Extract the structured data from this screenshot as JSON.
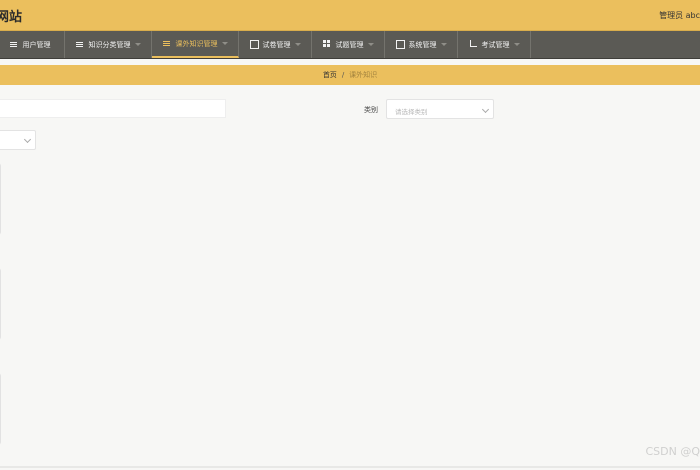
{
  "header": {
    "site_title": "网站",
    "user_info": "管理员 abc"
  },
  "nav": {
    "items": [
      {
        "label": "用户管理",
        "icon": "list-icon",
        "active": false
      },
      {
        "label": "知识分类管理",
        "icon": "list-icon",
        "active": false
      },
      {
        "label": "课外知识管理",
        "icon": "list-icon",
        "active": true
      },
      {
        "label": "试卷管理",
        "icon": "document-icon",
        "active": false
      },
      {
        "label": "试题管理",
        "icon": "grid-icon",
        "active": false
      },
      {
        "label": "系统管理",
        "icon": "settings-icon",
        "active": false
      },
      {
        "label": "考试管理",
        "icon": "crop-icon",
        "active": false
      }
    ]
  },
  "breadcrumb": {
    "home": "首页",
    "separator": "/",
    "current": "课外知识"
  },
  "filters": {
    "search_value": "",
    "category_label": "类别",
    "category_placeholder": "请选择类别"
  },
  "watermark": "CSDN @Q",
  "colors": {
    "accent": "#ebbf5d",
    "nav_bg": "#5b5a55",
    "page_bg": "#f7f7f5"
  }
}
